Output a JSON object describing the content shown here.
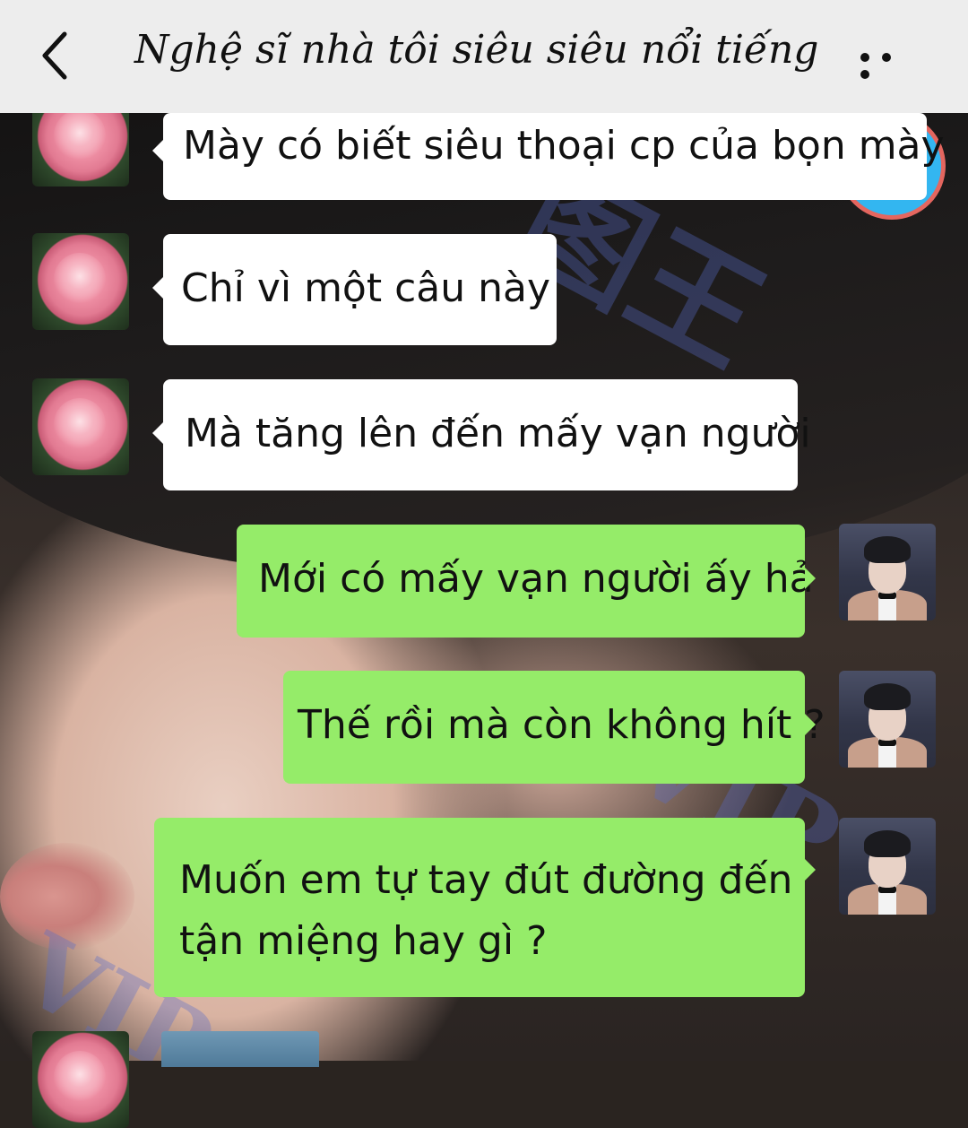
{
  "header": {
    "title": "Nghệ sĩ nhà tôi siêu siêu nổi tiếng",
    "back_icon": "chevron-left-icon",
    "more_icon": "more-horizontal-icon",
    "background": "#ededed"
  },
  "colors": {
    "incoming_bubble": "#ffffff",
    "outgoing_bubble": "#95ec69"
  },
  "messages": [
    {
      "sender": "other",
      "avatar": "rose-avatar",
      "text": "Mày có biết siêu thoại cp của bọn mày"
    },
    {
      "sender": "other",
      "avatar": "rose-avatar",
      "text": "Chỉ vì một câu này"
    },
    {
      "sender": "other",
      "avatar": "rose-avatar",
      "text": "Mà tăng lên đến mấy vạn người"
    },
    {
      "sender": "me",
      "avatar": "man-avatar",
      "text": "Mới có mấy vạn người ấy hả"
    },
    {
      "sender": "me",
      "avatar": "man-avatar",
      "text": "Thế rồi mà còn không hít ?"
    },
    {
      "sender": "me",
      "avatar": "man-avatar",
      "text_line1": "Muốn em tự tay đút đường đến",
      "text_line2": "tận miệng hay gì ?"
    }
  ]
}
